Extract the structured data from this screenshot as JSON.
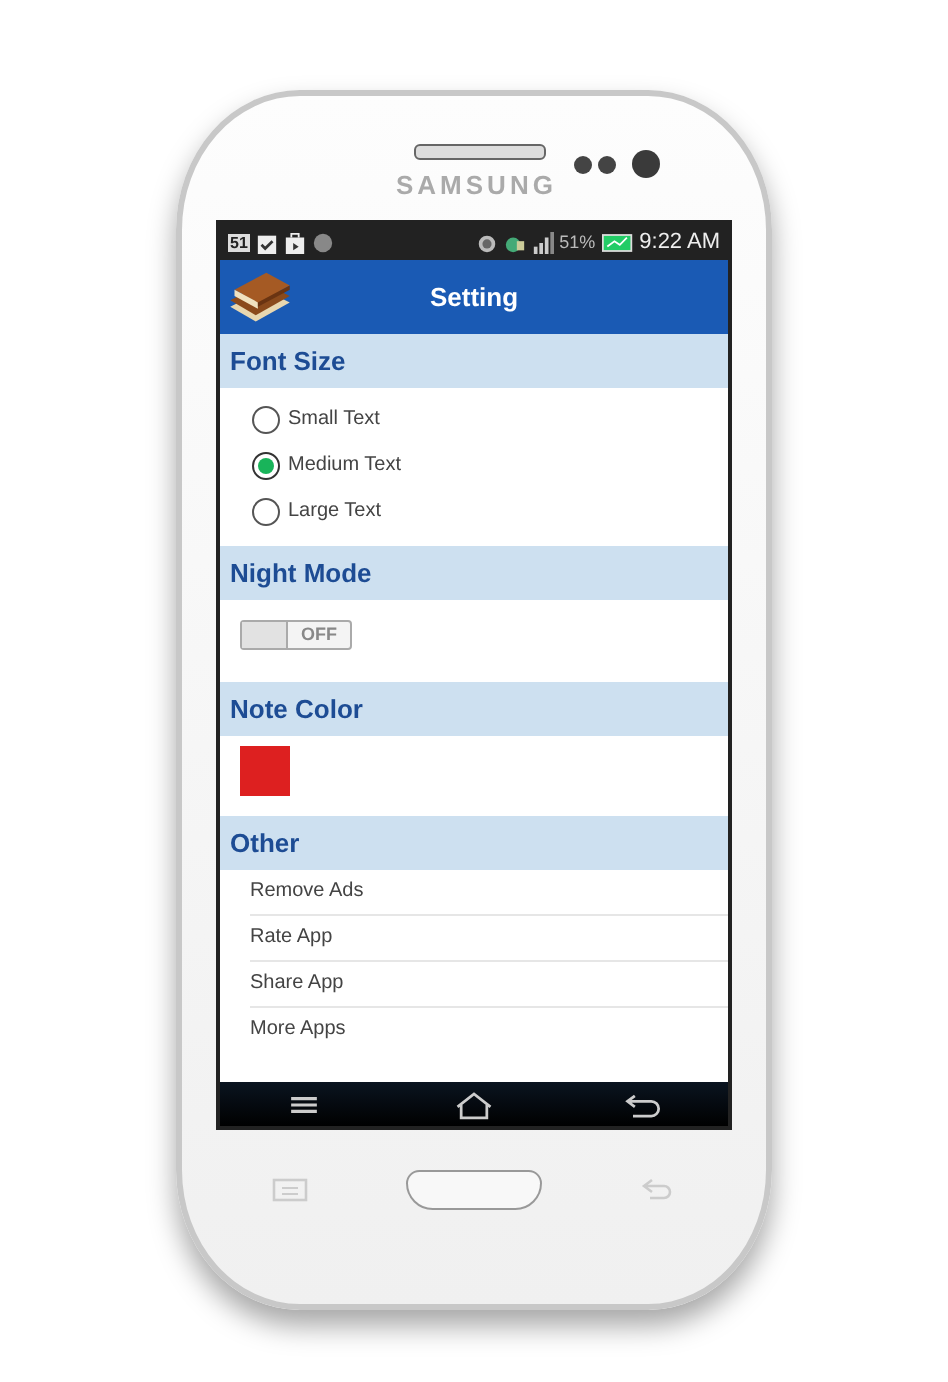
{
  "device": {
    "brand": "SAMSUNG"
  },
  "status_bar": {
    "badge": "51",
    "battery": "51%",
    "time": "9:22 AM"
  },
  "app_bar": {
    "title": "Setting"
  },
  "sections": [
    {
      "kind": "radio",
      "title": "Font Size",
      "options": [
        {
          "label": "Small Text",
          "selected": false
        },
        {
          "label": "Medium Text",
          "selected": true
        },
        {
          "label": "Large Text",
          "selected": false
        }
      ]
    },
    {
      "kind": "toggle",
      "title": "Night Mode",
      "toggle": {
        "label": "OFF",
        "on": false
      }
    },
    {
      "kind": "color",
      "title": "Note Color",
      "color": "#dd2020"
    },
    {
      "kind": "list",
      "title": "Other",
      "items": [
        "Remove Ads",
        "Rate App",
        "Share App",
        "More Apps"
      ]
    }
  ]
}
